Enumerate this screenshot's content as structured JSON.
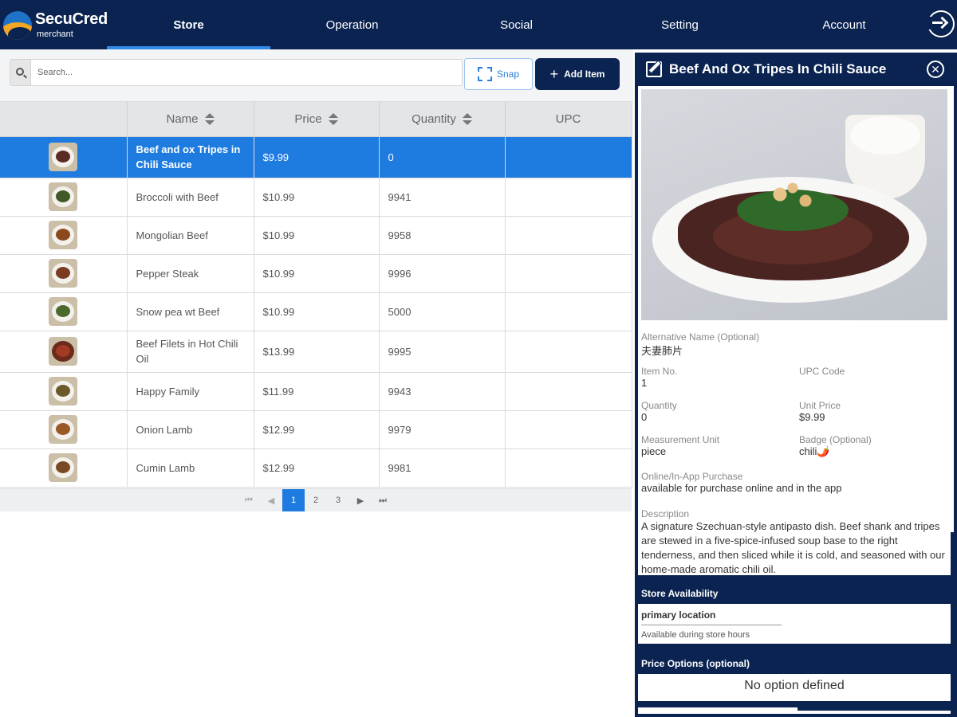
{
  "app": {
    "logo_name": "SecuCred",
    "logo_sub": "merchant"
  },
  "nav": {
    "tabs": [
      "Store",
      "Operation",
      "Social",
      "Setting",
      "Account"
    ],
    "active": "Store"
  },
  "toolbar": {
    "search_placeholder": "Search...",
    "snap_label": "Snap",
    "add_label": "Add Item"
  },
  "table": {
    "headers": {
      "name": "Name",
      "price": "Price",
      "quantity": "Quantity",
      "upc": "UPC"
    },
    "rows": [
      {
        "name": "Beef and ox Tripes in Chili Sauce",
        "price": "$9.99",
        "quantity": "0",
        "upc": ""
      },
      {
        "name": "Broccoli with Beef",
        "price": "$10.99",
        "quantity": "9941",
        "upc": ""
      },
      {
        "name": "Mongolian Beef",
        "price": "$10.99",
        "quantity": "9958",
        "upc": ""
      },
      {
        "name": "Pepper Steak",
        "price": "$10.99",
        "quantity": "9996",
        "upc": ""
      },
      {
        "name": "Snow pea wt Beef",
        "price": "$10.99",
        "quantity": "5000",
        "upc": ""
      },
      {
        "name": "Beef Filets in Hot Chili Oil",
        "price": "$13.99",
        "quantity": "9995",
        "upc": ""
      },
      {
        "name": "Happy Family",
        "price": "$11.99",
        "quantity": "9943",
        "upc": ""
      },
      {
        "name": "Onion Lamb",
        "price": "$12.99",
        "quantity": "9979",
        "upc": ""
      },
      {
        "name": "Cumin Lamb",
        "price": "$12.99",
        "quantity": "9981",
        "upc": ""
      }
    ]
  },
  "pager": {
    "first": "⏮",
    "prev": "◀",
    "pages": [
      "1",
      "2",
      "3"
    ],
    "current": "1",
    "next": "▶",
    "last": "⏭"
  },
  "detail": {
    "title": "Beef And Ox Tripes In Chili Sauce",
    "alt_name_label": "Alternative Name (Optional)",
    "alt_name": "夫妻肺片",
    "item_no_label": "Item No.",
    "item_no": "1",
    "upc_label": "UPC Code",
    "upc": "",
    "quantity_label": "Quantity",
    "quantity": "0",
    "unit_price_label": "Unit Price",
    "unit_price": "$9.99",
    "measurement_label": "Measurement Unit",
    "measurement": "piece",
    "badge_label": "Badge (Optional)",
    "badge": "chili🌶️",
    "online_label": "Online/In-App Purchase",
    "online": "available for purchase online and in the app",
    "description_label": "Description",
    "description": "A signature Szechuan-style antipasto dish. Beef shank and tripes are stewed in a five-spice-infused soup base to the right tenderness, and then sliced while it is cold, and seasoned with our home-made aromatic chili oil."
  },
  "store_availability": {
    "title": "Store Availability",
    "location": "primary location",
    "hours": "Available during store hours"
  },
  "price_options": {
    "title": "Price Options (optional)",
    "empty": "No option defined"
  },
  "colors": {
    "brand_navy": "#0a2350",
    "selected_blue": "#1e7be0",
    "snap_blue": "#2f7fd8"
  }
}
